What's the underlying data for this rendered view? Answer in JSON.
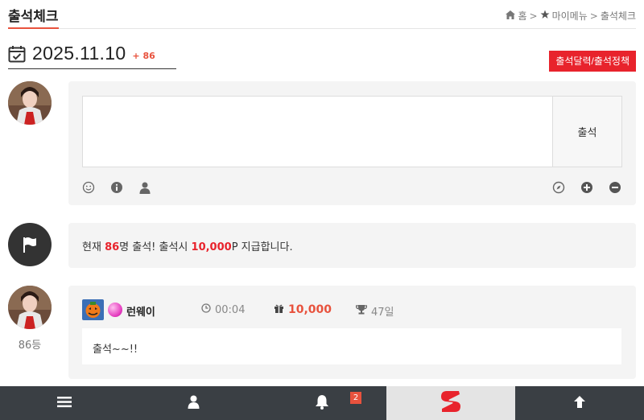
{
  "header": {
    "title": "출석체크",
    "breadcrumb": {
      "home": "홈",
      "sep1": ">",
      "mymenu": "마이메뉴",
      "sep2": ">",
      "current": "출석체크"
    }
  },
  "date_row": {
    "date": "2025.11.10",
    "count": "+ 86",
    "policy_button": "출석달력/출석정책"
  },
  "write_box": {
    "placeholder": "",
    "submit_label": "출석",
    "left_tools": [
      "smile-icon",
      "info-icon",
      "user-icon"
    ],
    "right_tools": [
      "compass-icon",
      "plus-circle-icon",
      "minus-circle-icon"
    ]
  },
  "notice": {
    "prefix": "현재 ",
    "count": "86",
    "mid": "명 출석! 출석시 ",
    "points": "10,000",
    "suffix": "P 지급합니다."
  },
  "entry": {
    "rank": "86등",
    "nickname": "런웨이",
    "time": "00:04",
    "points": "10,000",
    "days": "47일",
    "message": "출석~~!!"
  },
  "bottom_nav": {
    "items": [
      "menu-icon",
      "user-icon",
      "bell-icon",
      "logo",
      "arrow-up-icon"
    ],
    "notification_count": "2"
  },
  "colors": {
    "accent": "#e8523d",
    "policy_red": "#e8232c",
    "nav_bg": "#3a3f44",
    "panel_bg": "#f4f4f4"
  }
}
